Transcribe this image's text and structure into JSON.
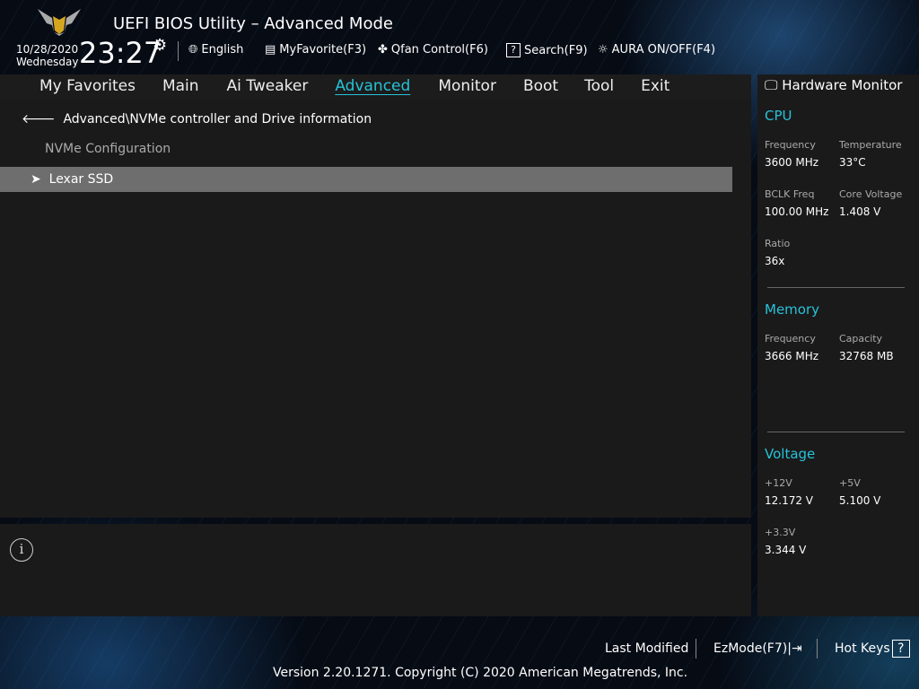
{
  "header": {
    "title": "UEFI BIOS Utility – Advanced Mode",
    "date": "10/28/2020",
    "day": "Wednesday",
    "time": "23:27",
    "toolbar": [
      {
        "label": "English",
        "icon": "globe-icon"
      },
      {
        "label": "MyFavorite(F3)",
        "icon": "favorite-list-icon"
      },
      {
        "label": "Qfan Control(F6)",
        "icon": "fan-icon"
      },
      {
        "label": "Search(F9)",
        "icon": "search-help-icon"
      },
      {
        "label": "AURA ON/OFF(F4)",
        "icon": "aura-light-icon"
      }
    ]
  },
  "nav": {
    "tabs": [
      "My Favorites",
      "Main",
      "Ai Tweaker",
      "Advanced",
      "Monitor",
      "Boot",
      "Tool",
      "Exit"
    ],
    "active": "Advanced"
  },
  "main": {
    "breadcrumb": "Advanced\\NVMe controller and Drive information",
    "section": "NVMe Configuration",
    "items": [
      {
        "label": "Lexar SSD"
      }
    ]
  },
  "hw": {
    "title": "Hardware Monitor",
    "cpu": {
      "title": "CPU",
      "freq_l": "Frequency",
      "freq": "3600 MHz",
      "temp_l": "Temperature",
      "temp": "33°C",
      "bclk_l": "BCLK Freq",
      "bclk": "100.00 MHz",
      "cv_l": "Core Voltage",
      "cv": "1.408 V",
      "ratio_l": "Ratio",
      "ratio": "36x"
    },
    "mem": {
      "title": "Memory",
      "freq_l": "Frequency",
      "freq": "3666 MHz",
      "cap_l": "Capacity",
      "cap": "32768 MB"
    },
    "volt": {
      "title": "Voltage",
      "v12_l": "+12V",
      "v12": "12.172 V",
      "v5_l": "+5V",
      "v5": "5.100 V",
      "v33_l": "+3.3V",
      "v33": "3.344 V"
    }
  },
  "footer": {
    "last_modified": "Last Modified",
    "ezmode": "EzMode(F7)",
    "hotkeys": "Hot Keys",
    "hotkeys_icon": "?",
    "copyright": "Version 2.20.1271. Copyright (C) 2020 American Megatrends, Inc."
  },
  "colors": {
    "accent": "#27c2d8",
    "highlight": "#6e6e6e"
  }
}
